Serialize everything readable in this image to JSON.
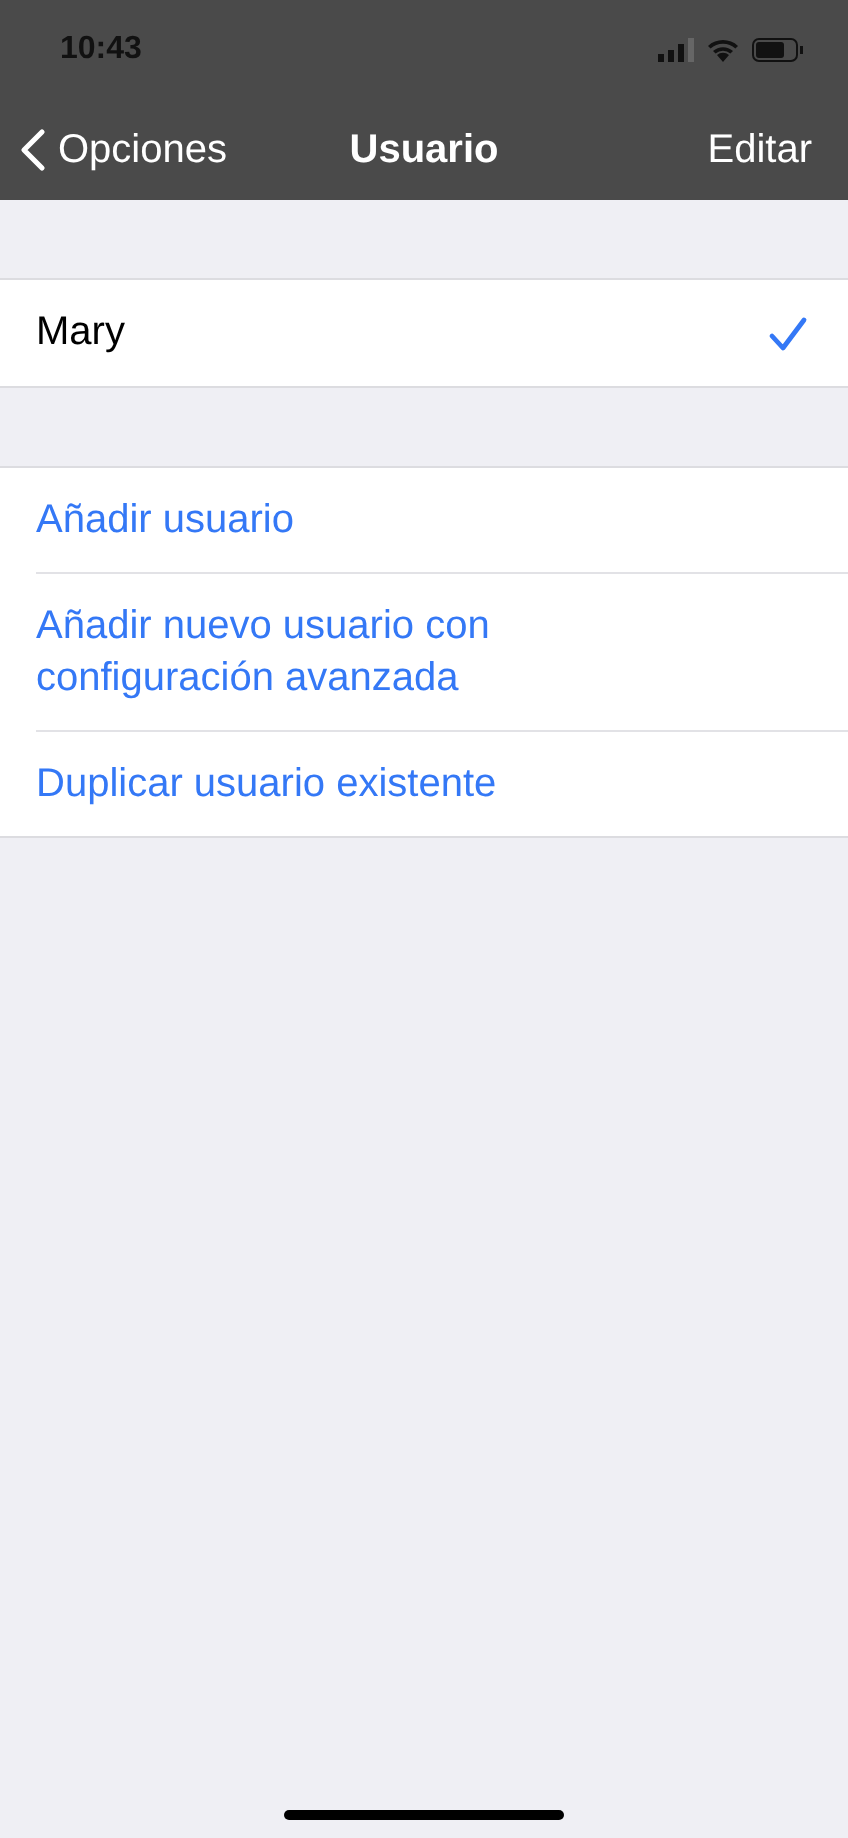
{
  "status_bar": {
    "time": "10:43"
  },
  "nav": {
    "back": "Opciones",
    "title": "Usuario",
    "action": "Editar"
  },
  "users": [
    {
      "name": "Mary",
      "selected": true
    }
  ],
  "actions": [
    {
      "label": "Añadir usuario"
    },
    {
      "label": "Añadir nuevo usuario con configuración avanzada"
    },
    {
      "label": "Duplicar usuario existente"
    }
  ]
}
